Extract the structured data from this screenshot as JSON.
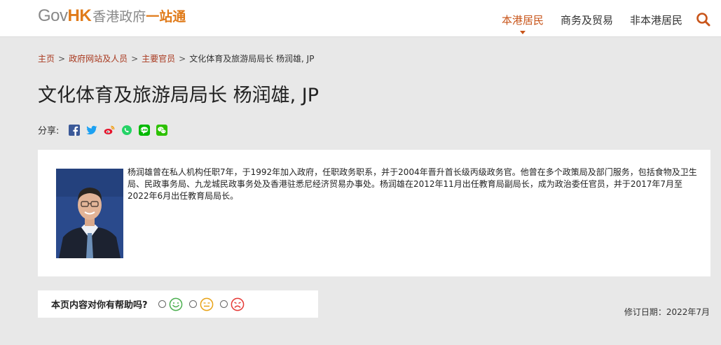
{
  "header": {
    "logo_gov": "Gov",
    "logo_hk": "HK",
    "logo_cn_gray": "香港政府",
    "logo_cn_orange": "一站通",
    "nav": [
      {
        "label": "本港居民",
        "active": true
      },
      {
        "label": "商务及贸易",
        "active": false
      },
      {
        "label": "非本港居民",
        "active": false
      }
    ],
    "search_icon": "search-icon"
  },
  "breadcrumb": {
    "items": [
      "主页",
      "政府网站及人员",
      "主要官员"
    ],
    "current": "文化体育及旅游局局长 杨润雄, JP",
    "separator": ">"
  },
  "page_title": "文化体育及旅游局局长 杨润雄, JP",
  "share": {
    "label": "分享:",
    "icons": [
      "facebook-icon",
      "twitter-icon",
      "weibo-icon",
      "whatsapp-icon",
      "line-icon",
      "wechat-icon"
    ]
  },
  "bio": "杨润雄曾在私人机构任职7年，于1992年加入政府，任职政务职系，并于2004年晋升首长级丙级政务官。他曾在多个政策局及部门服务，包括食物及卫生局、民政事务局、九龙城民政事务处及香港驻悉尼经济贸易办事处。杨润雄在2012年11月出任教育局副局长，成为政治委任官员，并于2017年7月至2022年6月出任教育局局长。",
  "feedback": {
    "question": "本页内容对你有帮助吗?",
    "options": [
      "happy-face-icon",
      "neutral-face-icon",
      "sad-face-icon"
    ]
  },
  "revision": "修订日期：2022年7月",
  "colors": {
    "accent": "#c8551a",
    "link": "#a8381e",
    "brand_orange": "#e07b1a",
    "background": "#e8e8e8"
  }
}
